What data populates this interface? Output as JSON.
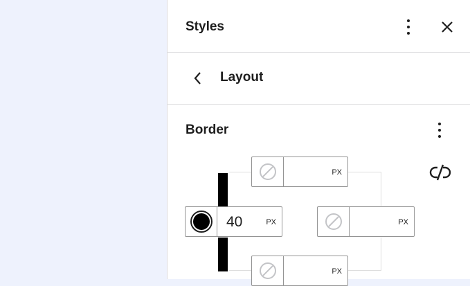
{
  "panel": {
    "title": "Styles",
    "nav_title": "Layout",
    "section_title": "Border"
  },
  "border": {
    "top": {
      "value": "",
      "unit": "PX"
    },
    "left": {
      "value": "40",
      "unit": "PX"
    },
    "right": {
      "value": "",
      "unit": "PX"
    },
    "bottom": {
      "value": "",
      "unit": "PX"
    },
    "left_color": "#000000"
  },
  "icons": {
    "options": "more-vertical-icon",
    "close": "close-icon",
    "back": "chevron-left-icon",
    "section_options": "more-vertical-icon",
    "unlink": "unlink-icon",
    "no_color": "no-color-swatch-icon"
  }
}
